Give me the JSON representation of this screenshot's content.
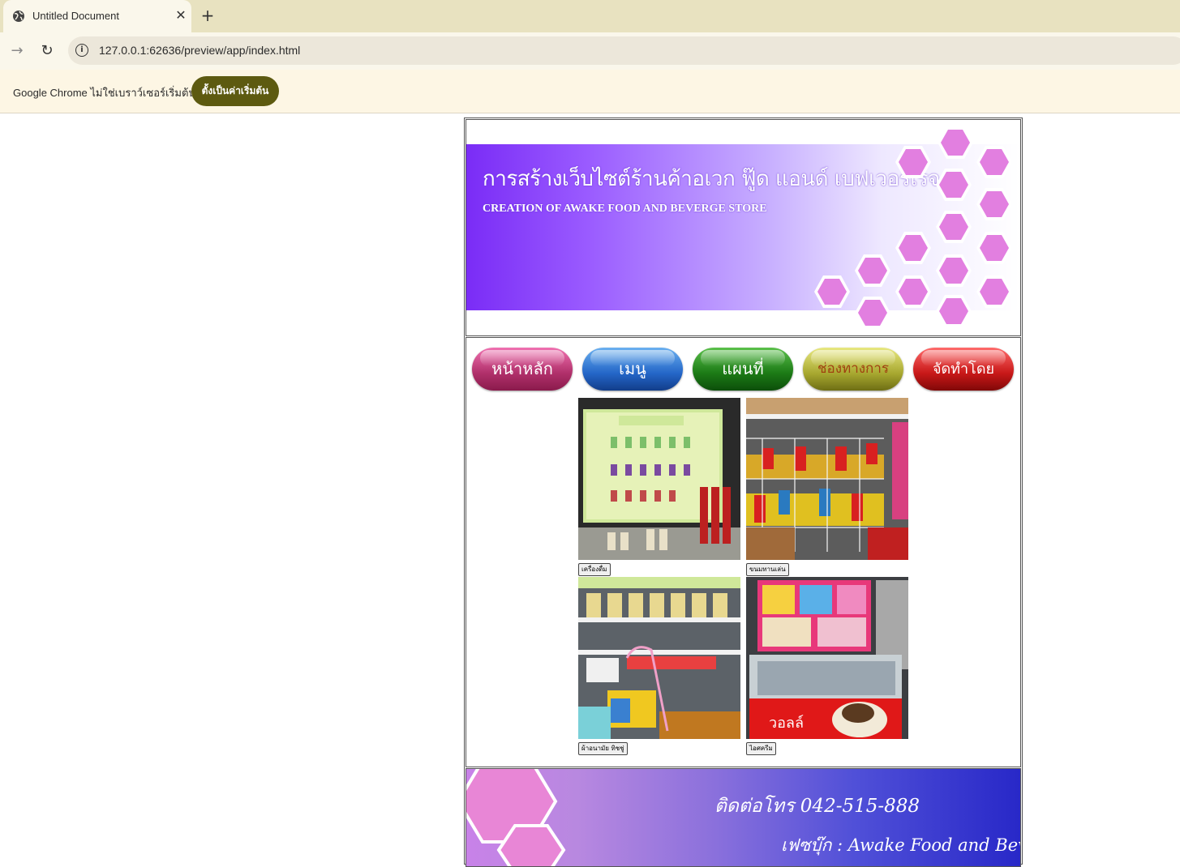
{
  "browser": {
    "tab_title": "Untitled Document",
    "close_glyph": "✕",
    "new_tab_glyph": "+",
    "url": "127.0.0.1:62636/preview/app/index.html",
    "infobar_text": "Google Chrome ไม่ใช่เบราว์เซอร์เริ่มต้น",
    "infobar_button": "ตั้งเป็นค่าเริ่มต้น"
  },
  "banner": {
    "title": "การสร้างเว็บไซต์ร้านค้าอเวก ฟู๊ด แอนด์ เบฟเวอร์เรจ",
    "subtitle": "CREATION OF AWAKE FOOD AND BEVERGE STORE"
  },
  "nav": {
    "home": "หน้าหลัก",
    "menu": "เมนู",
    "map": "แผนที่",
    "contact": "ช่องทางการติดต่อ",
    "author": "จัดทำโดย"
  },
  "gallery": [
    {
      "caption": "เครื่องดื่ม",
      "image": "drinks-menu-board"
    },
    {
      "caption": "ขนมทานเล่น",
      "image": "snack-rack"
    },
    {
      "caption": "ผ้าอนามัย ทิชชู่",
      "image": "shelf-sanitary"
    },
    {
      "caption": "ไอศครีม",
      "image": "ice-cream-freezer"
    }
  ],
  "footer": {
    "phone": "ติดต่อโทร  042-515-888",
    "facebook": "เฟซบุ๊ก : Awake Food and Beverage"
  },
  "colors": {
    "tabbar": "#e8e2c0",
    "infobar_button": "#5d5a10",
    "banner_purple": "#7a2cf6",
    "hex_pink": "#e27fe0"
  }
}
